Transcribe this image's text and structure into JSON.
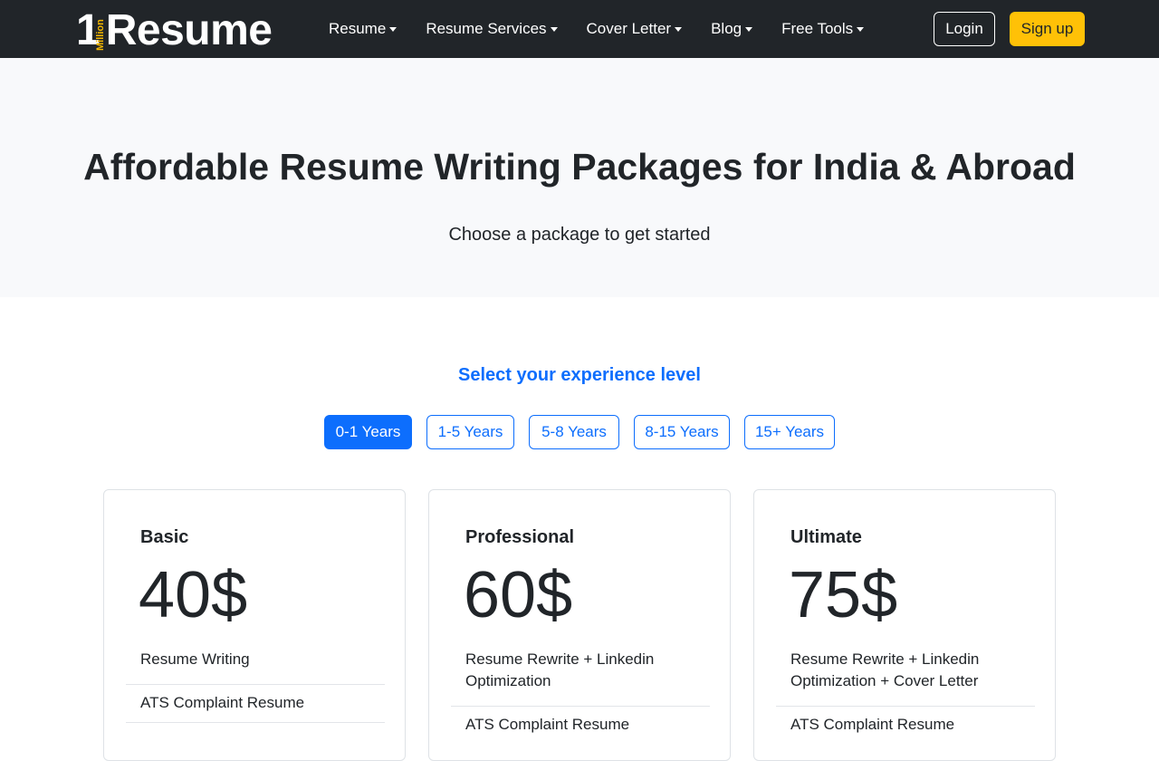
{
  "brand": {
    "one": "1",
    "million": "Million",
    "word": "Resume",
    "accent_color": "#f5b800"
  },
  "nav": {
    "items": [
      {
        "label": "Resume"
      },
      {
        "label": "Resume Services"
      },
      {
        "label": "Cover Letter"
      },
      {
        "label": "Blog"
      },
      {
        "label": "Free Tools"
      }
    ],
    "login": "Login",
    "signup": "Sign up",
    "signup_color": "#ffc107",
    "bg_color": "#212529"
  },
  "hero": {
    "title": "Affordable Resume Writing Packages for India & Abroad",
    "subtitle": "Choose a package to get started"
  },
  "experience": {
    "heading": "Select your experience level",
    "options": [
      "0-1 Years",
      "1-5 Years",
      "5-8 Years",
      "8-15 Years",
      "15+ Years"
    ],
    "selected": "0-1 Years",
    "accent_color": "#0d6efd"
  },
  "packages": [
    {
      "name": "Basic",
      "price": "40$",
      "description": "Resume Writing",
      "features": [
        "ATS Complaint Resume"
      ]
    },
    {
      "name": "Professional",
      "price": "60$",
      "description": "Resume Rewrite + Linkedin Optimization",
      "features": [
        "ATS Complaint Resume"
      ]
    },
    {
      "name": "Ultimate",
      "price": "75$",
      "description": "Resume Rewrite + Linkedin Optimization + Cover Letter",
      "features": [
        "ATS Complaint Resume"
      ]
    }
  ]
}
